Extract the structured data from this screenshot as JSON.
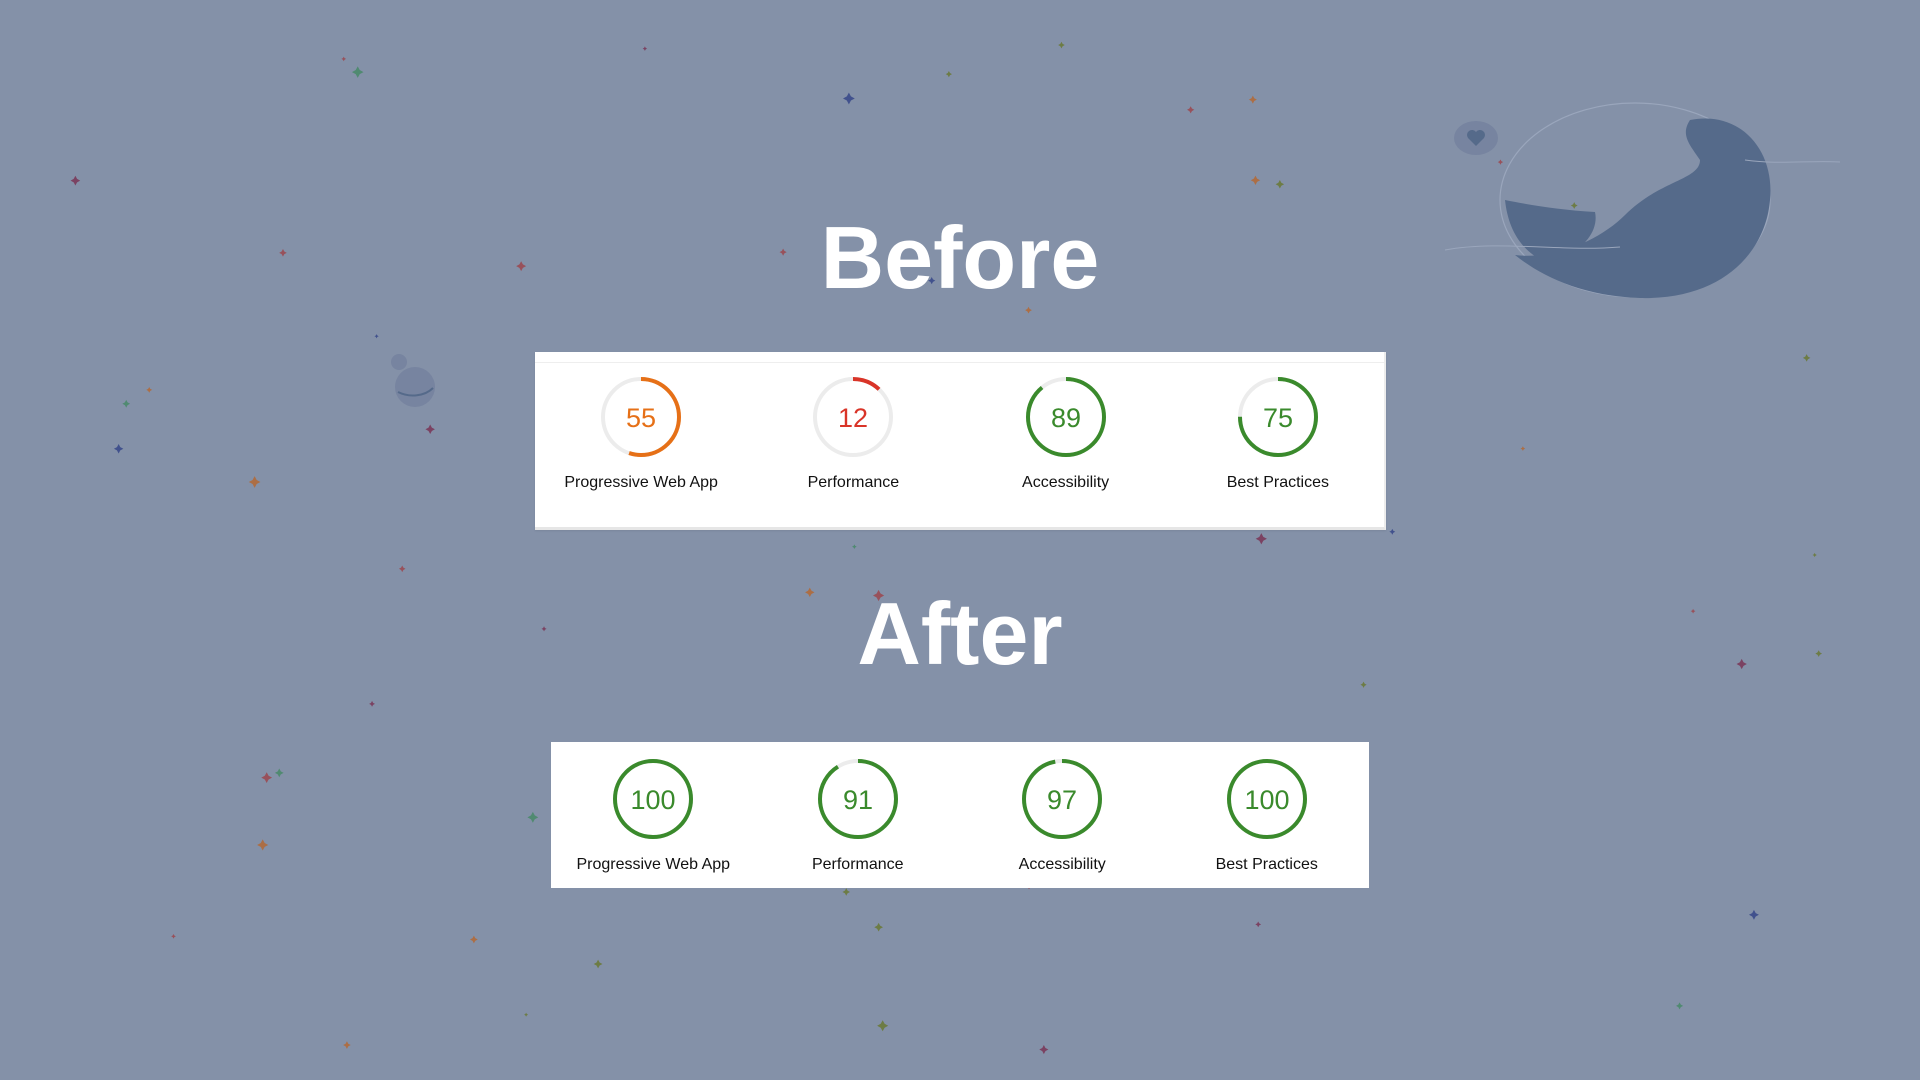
{
  "colors": {
    "background": "#8491a8",
    "pass": "#3a8a2c",
    "average": "#e67017",
    "fail": "#d93428",
    "track": "#ececec",
    "planet": "#556a8a"
  },
  "icons": [
    "planet-illustration",
    "heart-speech-bubble-icon",
    "small-planet-icon",
    "star-icon"
  ],
  "before": {
    "title": "Before",
    "scores": [
      {
        "label": "Progressive Web App",
        "score": 55,
        "rating": "average"
      },
      {
        "label": "Performance",
        "score": 12,
        "rating": "fail"
      },
      {
        "label": "Accessibility",
        "score": 89,
        "rating": "pass"
      },
      {
        "label": "Best Practices",
        "score": 75,
        "rating": "pass"
      }
    ]
  },
  "after": {
    "title": "After",
    "scores": [
      {
        "label": "Progressive Web App",
        "score": 100,
        "rating": "pass"
      },
      {
        "label": "Performance",
        "score": 91,
        "rating": "pass"
      },
      {
        "label": "Accessibility",
        "score": 97,
        "rating": "pass"
      },
      {
        "label": "Best Practices",
        "score": 100,
        "rating": "pass"
      }
    ]
  }
}
